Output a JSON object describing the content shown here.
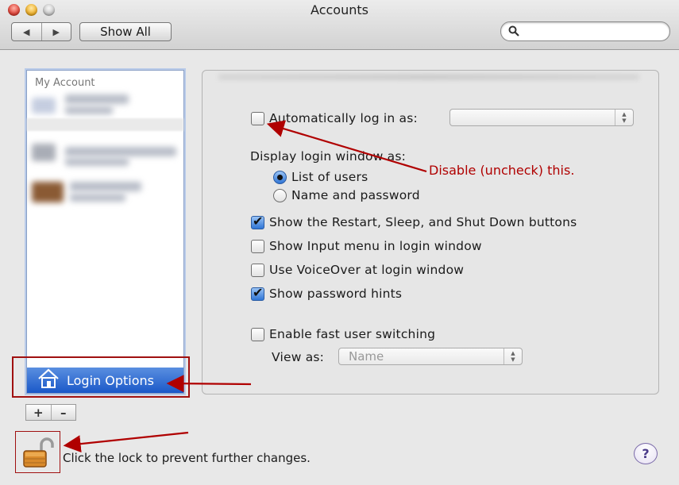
{
  "window": {
    "title": "Accounts"
  },
  "toolbar": {
    "back_glyph": "◀",
    "forward_glyph": "▶",
    "show_all_label": "Show All",
    "search_placeholder": ""
  },
  "sidebar": {
    "header": "My Account",
    "selected_item_label": "Login Options",
    "add_glyph": "+",
    "remove_glyph": "–"
  },
  "options": {
    "auto_login_label": "Automatically log in as:",
    "auto_login_checked": false,
    "display_heading": "Display login window as:",
    "radio_list_label": "List of users",
    "radio_name_label": "Name and password",
    "restart_label": "Show the Restart, Sleep, and Shut Down buttons",
    "input_menu_label": "Show Input menu in login window",
    "voiceover_label": "Use VoiceOver at login window",
    "hints_label": "Show password hints",
    "fast_switch_label": "Enable fast user switching",
    "view_as_label": "View as:",
    "view_as_value": "Name"
  },
  "footer": {
    "lock_text": "Click the lock to prevent further changes.",
    "help_glyph": "?"
  },
  "annotations": {
    "callout_text": "Disable (uncheck) this.",
    "color": "#b00000"
  }
}
